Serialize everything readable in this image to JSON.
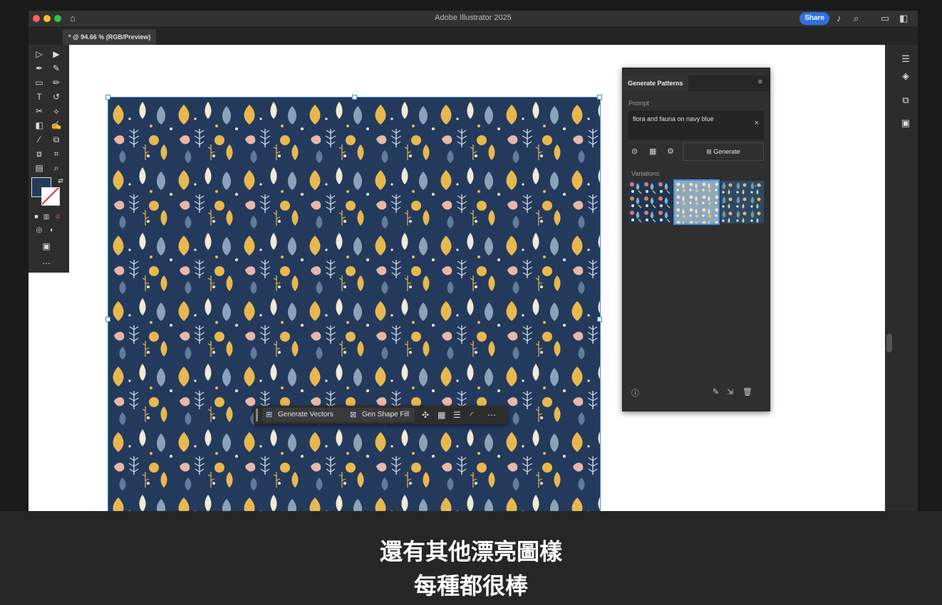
{
  "window": {
    "title": "Adobe Illustrator 2025",
    "share_label": "Share"
  },
  "document": {
    "tab_label": "* @ 94.66 % (RGB/Preview)"
  },
  "panel": {
    "title": "Generate Patterns",
    "prompt_label": "Prompt",
    "prompt_value": "flora and fauna on navy blue",
    "generate_label": "Generate",
    "variations_label": "Variations"
  },
  "context_bar": {
    "generate_vectors": "Generate Vectors",
    "gen_shape_fill": "Gen Shape Fill"
  },
  "caption": {
    "line1": "還有其他漂亮圖樣",
    "line2": "每種都很棒"
  },
  "colors": {
    "navy": "#233a5c",
    "accent": "#2d6fe0",
    "mustard": "#e8b84f",
    "blush": "#e9b7a8",
    "slate": "#8aa3b8",
    "cream": "#f1ead6"
  }
}
